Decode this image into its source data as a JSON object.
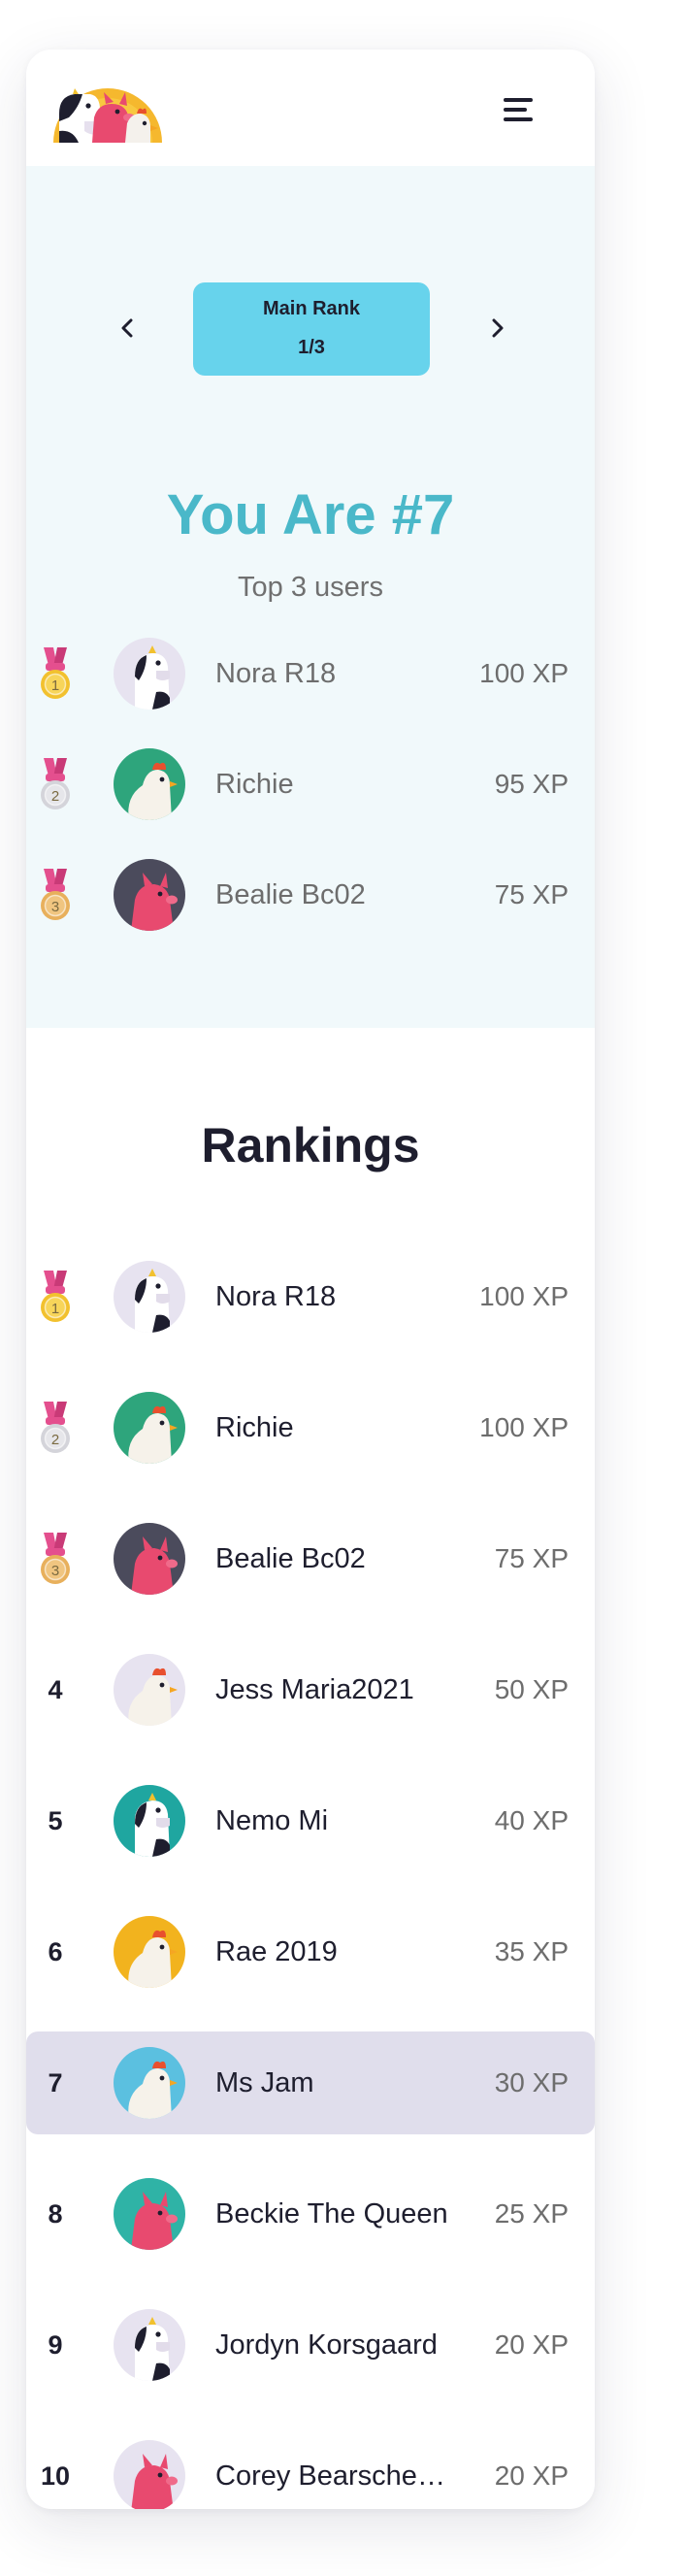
{
  "header": {
    "logo_icon": "animals-logo-icon",
    "menu_icon": "hamburger-menu-icon"
  },
  "rank_switcher": {
    "label": "Main Rank",
    "page": "1/3",
    "prev_icon": "chevron-left-icon",
    "next_icon": "chevron-right-icon"
  },
  "position": {
    "headline": "You Are #7",
    "subtitle": "Top 3 users"
  },
  "top3": [
    {
      "medal": "gold-medal-icon",
      "medal_number": "1",
      "avatar": "cow-avatar",
      "name": "Nora R18",
      "xp": "100 XP"
    },
    {
      "medal": "silver-medal-icon",
      "medal_number": "2",
      "avatar": "chicken-avatar",
      "name": "Richie",
      "xp": "95 XP"
    },
    {
      "medal": "bronze-medal-icon",
      "medal_number": "3",
      "avatar": "pig-avatar",
      "name": "Bealie Bc02",
      "xp": "75 XP"
    }
  ],
  "rankings": {
    "title": "Rankings",
    "rows": [
      {
        "rank": "",
        "medal": "gold-medal-icon",
        "medal_number": "1",
        "avatar": "cow-avatar",
        "name": "Nora R18",
        "xp": "100 XP"
      },
      {
        "rank": "",
        "medal": "silver-medal-icon",
        "medal_number": "2",
        "avatar": "chicken-avatar",
        "name": "Richie",
        "xp": "100 XP"
      },
      {
        "rank": "",
        "medal": "bronze-medal-icon",
        "medal_number": "3",
        "avatar": "pig-avatar",
        "name": "Bealie Bc02",
        "xp": "75 XP"
      },
      {
        "rank": "4",
        "avatar": "chicken-avatar",
        "name": "Jess Maria2021",
        "xp": "50 XP"
      },
      {
        "rank": "5",
        "avatar": "cow-avatar",
        "name": "Nemo Mi",
        "xp": "40 XP"
      },
      {
        "rank": "6",
        "avatar": "chicken-avatar",
        "name": "Rae 2019",
        "xp": "35 XP"
      },
      {
        "rank": "7",
        "avatar": "chicken-avatar",
        "name": "Ms Jam",
        "xp": "30 XP",
        "current_user": true
      },
      {
        "rank": "8",
        "avatar": "pig-avatar",
        "name": "Beckie The Queen",
        "xp": "25 XP"
      },
      {
        "rank": "9",
        "avatar": "cow-avatar",
        "name": "Jordyn Korsgaard",
        "xp": "20 XP"
      },
      {
        "rank": "10",
        "avatar": "pig-avatar",
        "name": "Corey Bearschei…",
        "xp": "20 XP"
      }
    ]
  },
  "colors": {
    "accent": "#67d3ec",
    "headline": "#4ab8c9",
    "top_bg": "#f1f9fb",
    "highlight_row": "#e0deec",
    "gold": "#f2c12e",
    "silver": "#cfcfd4",
    "bronze": "#e8b05c",
    "ribbon": "#e44f8e"
  }
}
